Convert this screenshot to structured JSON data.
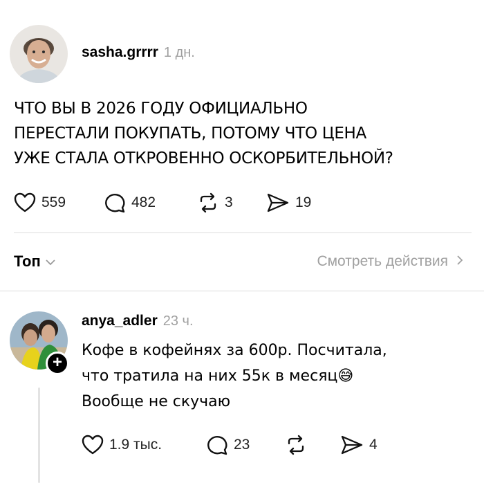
{
  "post": {
    "author": "sasha.grrrr",
    "time": "1 дн.",
    "text_lines": [
      "ЧТО ВЫ В 2026 ГОДУ ОФИЦИАЛЬНО",
      "ПЕРЕСТАЛИ ПОКУПАТЬ, ПОТОМУ ЧТО ЦЕНА",
      "УЖЕ СТАЛА ОТКРОВЕННО ОСКОРБИТЕЛЬНОЙ?"
    ],
    "stats": {
      "likes": "559",
      "comments": "482",
      "reposts": "3",
      "shares": "19"
    }
  },
  "controls": {
    "sort_label": "Топ",
    "view_activity": "Смотреть действия"
  },
  "comment": {
    "author": "anya_adler",
    "time": "23 ч.",
    "text_lines": [
      "Кофе в кофейнях за 600р. Посчитала,",
      "что тратила на них 55к в месяц😅",
      "Вообще не скучаю"
    ],
    "stats": {
      "likes": "1.9 тыс.",
      "comments": "23",
      "reposts": "",
      "shares": "4"
    }
  },
  "icons": {
    "like": "heart-icon",
    "comment": "comment-bubble-icon",
    "repost": "repost-icon",
    "share": "send-icon",
    "sort_chevron": "chevron-down-icon",
    "activity_chevron": "chevron-right-icon",
    "follow": "plus-icon"
  }
}
